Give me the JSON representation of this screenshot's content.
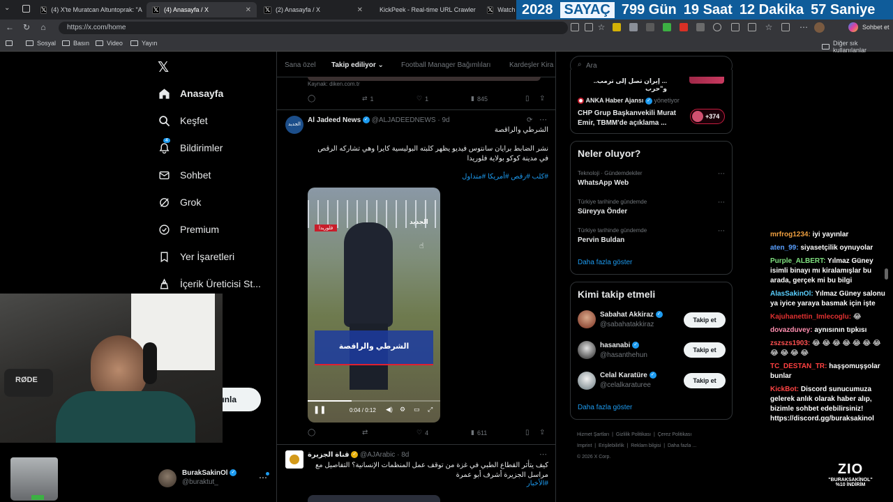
{
  "tabs": [
    {
      "label": "(4) X'te Muratcan Altuntoprak: \"A",
      "icon": "x-logo"
    },
    {
      "label": "(4) Anasayfa / X",
      "icon": "x-logo"
    },
    {
      "label": "(2) Anasayfa / X",
      "icon": "x-logo"
    },
    {
      "label": "KickPeek - Real-time URL Crawler",
      "icon": "kick-icon"
    },
    {
      "label": "Watch Fr",
      "icon": "x-logo"
    }
  ],
  "countdown": {
    "year": "2028",
    "label": "SAYAÇ",
    "days": "799 Gün",
    "hours": "19 Saat",
    "minutes": "12 Dakika",
    "seconds": "57 Saniye"
  },
  "address_bar": {
    "url": "https://x.com/home",
    "profile_label": "Sohbet et"
  },
  "bookmarks": {
    "items": [
      "Sosyal",
      "Basın",
      "Video",
      "Yayın"
    ],
    "other": "Diğer sık kullanılanlar"
  },
  "nav": {
    "items": [
      {
        "label": "Anasayfa",
        "icon": "home-icon"
      },
      {
        "label": "Keşfet",
        "icon": "search-icon"
      },
      {
        "label": "Bildirimler",
        "icon": "bell-icon",
        "badge": "4"
      },
      {
        "label": "Sohbet",
        "icon": "mail-icon"
      },
      {
        "label": "Grok",
        "icon": "grok-icon"
      },
      {
        "label": "Premium",
        "icon": "premium-icon"
      },
      {
        "label": "Yer İşaretleri",
        "icon": "bookmark-icon"
      },
      {
        "label": "İçerik Üreticisi St...",
        "icon": "creator-icon"
      }
    ],
    "post_button": "ınla",
    "account": {
      "name": "BurakSakinOl",
      "handle": "@buraktut_"
    }
  },
  "feed": {
    "tabs": [
      "Sana özel",
      "Takip ediliyor",
      "Football Manager Bağımlıları",
      "Kardeşler Kira"
    ],
    "prev_post": {
      "source": "Kaynak: diken.com.tr",
      "retweets": "1",
      "likes": "1",
      "views": "845"
    },
    "post1": {
      "author": "Al Jadeed News",
      "handle": "@ALJADEEDNEWS",
      "time": "9d",
      "line1": "الشرطي والراقصة",
      "body": "نشر الضابط برايان سانتوس فيديو يظهر كلبته البوليسية كايرا وهي تشاركه الرقص في مدينة كوكو بولاية فلوريدا",
      "hashtags": "#كلب #رقص #أمريكا #متداول",
      "video_caption": "الشرطي والراقصة",
      "video_tag": "فلوريدا",
      "video_logo": "الجديد",
      "video_time": "0:04 / 0:12",
      "likes": "4",
      "views": "611"
    },
    "post2": {
      "author": "قناة الجزيرة",
      "handle": "@AJArabic",
      "time": "8d",
      "body": "كيف يتأثر القطاع الطبي في غزة من توقف عمل المنظمات الإنسانية؟ التفاصيل مع مراسل الجزيرة أشرف أبو عمرة",
      "hashtags": "#الأخبار"
    }
  },
  "right": {
    "search_placeholder": "Ara",
    "top_news": {
      "headline_partial": "... إيران تصل إلى ترمب.. و\"حرب",
      "source": "ANKA Haber Ajansı",
      "source_suffix": "yönetiyor",
      "headline": "CHP Grup Başkanvekili Murat Emir, TBMM'de açıklama ...",
      "count": "+374"
    },
    "trends": {
      "title": "Neler oluyor?",
      "items": [
        {
          "meta": "Teknoloji · Gündemdekiler",
          "name": "WhatsApp Web"
        },
        {
          "meta": "Türkiye tarihinde gündemde",
          "name": "Süreyya Önder"
        },
        {
          "meta": "Türkiye tarihinde gündemde",
          "name": "Pervin Buldan"
        }
      ],
      "more": "Daha fazla göster"
    },
    "who_to_follow": {
      "title": "Kimi takip etmeli",
      "items": [
        {
          "name": "Sabahat Akkiraz",
          "handle": "@sabahatakkiraz",
          "badge": "blue"
        },
        {
          "name": "hasanabi",
          "handle": "@hasanthehun",
          "badge": "blue"
        },
        {
          "name": "Celal Karatüre",
          "handle": "@celalkaraturee",
          "badge": "blue"
        }
      ],
      "follow_label": "Takip et",
      "more": "Daha fazla göster"
    },
    "footer": {
      "links": [
        "Hizmet Şartları",
        "Gizlilik Politikası",
        "Çerez Politikası",
        "Imprint",
        "Erişilebilirlik",
        "Reklam bilgisi",
        "Daha fazla ..."
      ],
      "copyright": "© 2026 X Corp."
    }
  },
  "chat": [
    {
      "user": "mrfrog1234:",
      "msg": " iyi yayınlar",
      "color": "#f0a040"
    },
    {
      "user": "aten_99:",
      "msg": " siyasetçilik oynuyolar",
      "color": "#5aa0ff"
    },
    {
      "user": "Purple_ALBERT:",
      "msg": " Yılmaz Güney isimli binayı mı kiralamışlar bu arada, gerçek mi bu bilgi",
      "color": "#7fe07f"
    },
    {
      "user": "AlasSakinOl:",
      "msg": " Yılmaz Güney salonu ya iyice yaraya basmak için işte",
      "color": "#5ad0ff"
    },
    {
      "user": "Kajuhanettin_Imlecoglu:",
      "msg": " 😂",
      "color": "#e03030"
    },
    {
      "user": "dovazduvey:",
      "msg": " aynısının tıpkısı",
      "color": "#ff8fb0"
    },
    {
      "user": "zszszs1903:",
      "msg": " 😂 😂 😂 😂 😂 😂 😂 😂 😂 😂 😂",
      "color": "#ff5050"
    },
    {
      "user": "TC_DESTAN_TR:",
      "msg": " haşşomuşşolar bunlar",
      "color": "#ff4040"
    },
    {
      "user": "KickBot:",
      "msg": " Discord sunucumuza gelerek anlık olarak haber alıp, bizimle sohbet edebilirsiniz! https://discord.gg/buraksakinol",
      "color": "#ff4444"
    }
  ],
  "overlay": {
    "mic_brand": "RØDE",
    "promo_logo": "ZIO",
    "promo_line1": "\"BURAKSAKİNOL\"",
    "promo_line2": "%10 İNDİRİM"
  }
}
